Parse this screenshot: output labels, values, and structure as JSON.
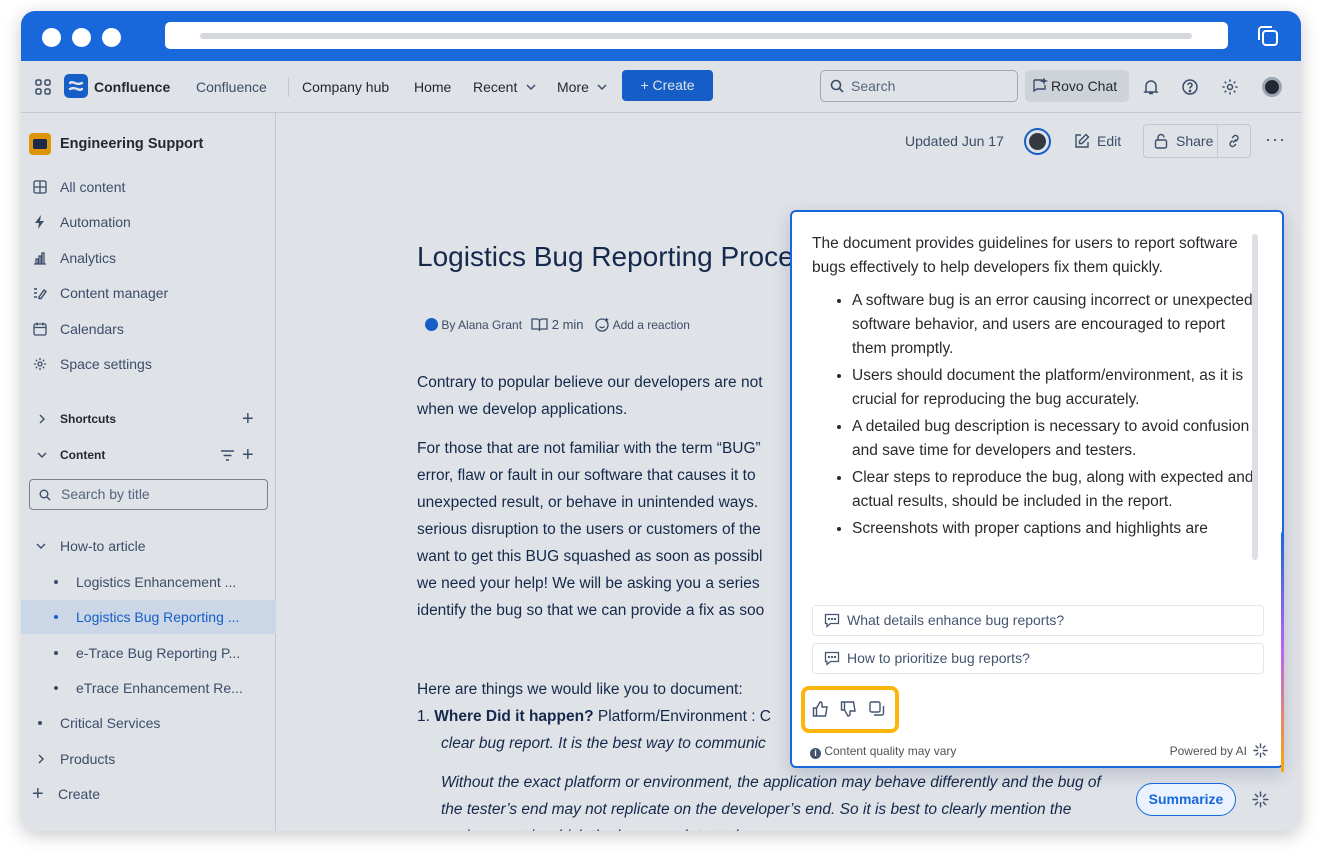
{
  "topnav": {
    "brand": "Confluence",
    "space_switcher": "Confluence",
    "items": [
      "Company hub",
      "Home",
      "Recent",
      "More"
    ],
    "create_label": "Create",
    "search_placeholder": "Search",
    "rovo_label": "Rovo Chat"
  },
  "sidebar": {
    "space_name": "Engineering Support",
    "items": [
      "All content",
      "Automation",
      "Analytics",
      "Content manager",
      "Calendars",
      "Space settings"
    ],
    "shortcuts_label": "Shortcuts",
    "content_label": "Content",
    "search_placeholder": "Search by title",
    "tree": {
      "root": "How-to article",
      "children": [
        "Logistics Enhancement ...",
        "Logistics Bug Reporting ...",
        "e-Trace Bug Reporting P...",
        "eTrace Enhancement Re..."
      ],
      "others": [
        "Critical Services",
        "Products"
      ],
      "create_label": "Create"
    }
  },
  "page": {
    "updated": "Updated Jun 17",
    "edit_label": "Edit",
    "share_label": "Share",
    "title": "Logistics Bug Reporting Process",
    "byline": "By Alana Grant",
    "read_time": "2 min",
    "reaction": "Add a reaction",
    "paragraph1": [
      "Contrary to popular believe our developers are not",
      "when we develop applications."
    ],
    "paragraph2": [
      "For those that are not familiar with the term “BUG”",
      "error, flaw or fault in our software that causes it to",
      "unexpected result, or behave in unintended ways.",
      "serious disruption to the users or customers of the",
      "want to get this BUG squashed as soon as possibl",
      "we need your help! We will be asking you a series",
      "identify the bug so that we can provide a fix as soo"
    ],
    "list_intro": "Here are things we would like you to document:",
    "item1_bold": "Where Did it happen?",
    "item1_rest": " Platform/Environment : C",
    "item1_line2": "clear bug report. It is the best way to communic",
    "italic_lines": [
      "Without the exact platform or environment, the application may behave differently and the bug of",
      "the tester’s end may not replicate on the developer’s end. So it is best to clearly mention the",
      "environment in which the bug was detected."
    ]
  },
  "ai_panel": {
    "intro": "The document provides guidelines for users to report software bugs effectively to help developers fix them quickly.",
    "bullets": [
      "A software bug is an error causing incorrect or unexpected software behavior, and users are encouraged to report them promptly.",
      "Users should document the platform/environment, as it is crucial for reproducing the bug accurately.",
      "A detailed bug description is necessary to avoid confusion and save time for developers and testers.",
      "Clear steps to reproduce the bug, along with expected and actual results, should be included in the report.",
      "Screenshots with proper captions and highlights are"
    ],
    "suggestions": [
      "What details enhance bug reports?",
      "How to prioritize bug reports?"
    ],
    "disclaimer": "Content quality may vary",
    "powered_by": "Powered by AI"
  },
  "summarize_label": "Summarize",
  "colors": {
    "brand": "#1868db",
    "highlight": "#fcb50b"
  }
}
